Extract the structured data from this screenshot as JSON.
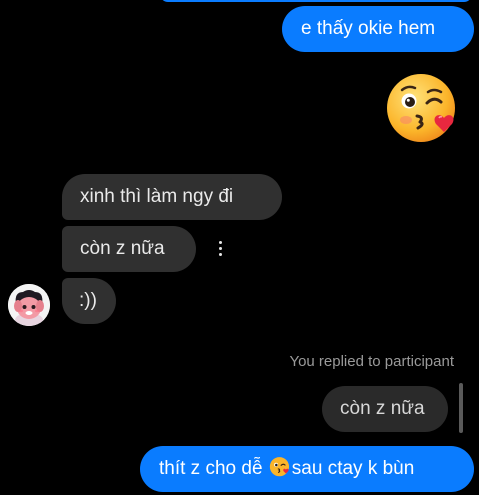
{
  "messages": {
    "outgoing_1": "e thấy okie hem",
    "big_emoji": "face-blowing-a-kiss",
    "incoming_1": "xinh thì làm ngy đi",
    "incoming_2": "còn z nữa",
    "incoming_3": ":))",
    "replied_note": "You replied to participant",
    "reply_quote": "còn z nữa",
    "outgoing_2_before": "thít z cho dễ ",
    "outgoing_2_emoji": "face-blowing-a-kiss",
    "outgoing_2_after": "sau ctay k bùn"
  },
  "icons": {
    "more": "more-vertical-icon",
    "avatar": "contact-avatar"
  },
  "colors": {
    "background": "#000000",
    "outgoing_bubble": "#0a7cff",
    "incoming_bubble": "#303030",
    "meta_text": "#9a9a9a"
  }
}
